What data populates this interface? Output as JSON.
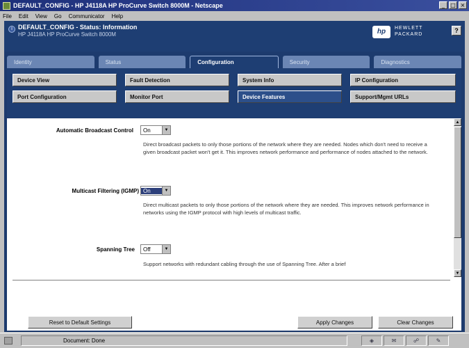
{
  "window": {
    "title": "DEFAULT_CONFIG - HP J4118A HP ProCurve Switch 8000M - Netscape",
    "controls": [
      "_",
      "□",
      "×"
    ]
  },
  "menubar": [
    "File",
    "Edit",
    "View",
    "Go",
    "Communicator",
    "Help"
  ],
  "header": {
    "title": "DEFAULT_CONFIG - Status: Information",
    "subtitle": "HP J4118A HP ProCurve Switch 8000M",
    "brand_line1": "HEWLETT",
    "brand_line2": "PACKARD",
    "logo": "hp",
    "help": "?"
  },
  "main_tabs": [
    {
      "label": "Identity",
      "active": false
    },
    {
      "label": "Status",
      "active": false
    },
    {
      "label": "Configuration",
      "active": true
    },
    {
      "label": "Security",
      "active": false
    },
    {
      "label": "Diagnostics",
      "active": false
    }
  ],
  "sub_tabs": [
    {
      "label": "Device View",
      "active": false
    },
    {
      "label": "Fault Detection",
      "active": false
    },
    {
      "label": "System Info",
      "active": false
    },
    {
      "label": "IP Configuration",
      "active": false
    },
    {
      "label": "Port Configuration",
      "active": false
    },
    {
      "label": "Monitor Port",
      "active": false
    },
    {
      "label": "Device Features",
      "active": true
    },
    {
      "label": "Support/Mgmt URLs",
      "active": false
    }
  ],
  "features": [
    {
      "label": "Automatic Broadcast Control",
      "value": "On",
      "description": "Direct broadcast packets to only those portions of the network where they are needed. Nodes which don't need to receive a given broadcast packet won't get it. This improves network performance and performance of nodes attached to the network."
    },
    {
      "label": "Multicast Filtering (IGMP)",
      "value": "On",
      "description": "Direct multicast packets to only those portions of the network where they are needed. This improves network performance in networks using the IGMP protocol with high levels of multicast traffic."
    },
    {
      "label": "Spanning Tree",
      "value": "Off",
      "description": "Support networks with redundant cabling through the use of Spanning Tree. After a brief"
    }
  ],
  "buttons": {
    "reset": "Reset to Default Settings",
    "apply": "Apply Changes",
    "clear": "Clear Changes"
  },
  "statusbar": {
    "text": "Document: Done"
  }
}
